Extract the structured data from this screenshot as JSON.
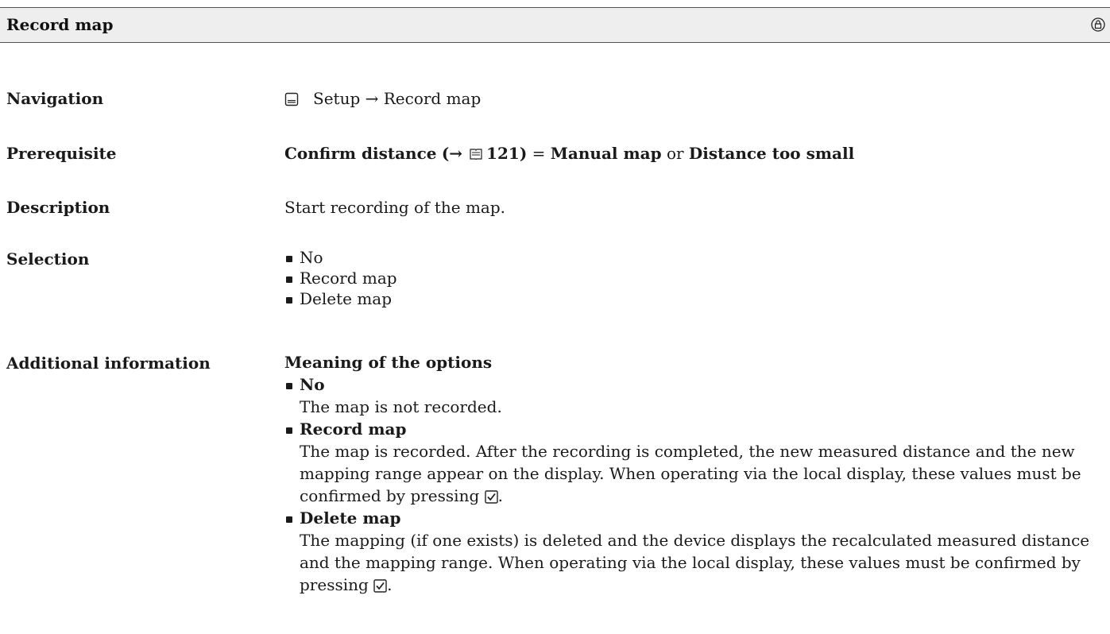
{
  "header": {
    "title": "Record map",
    "icon": "lock-icon"
  },
  "navigation": {
    "label": "Navigation",
    "path": "Setup → Record map",
    "icon": "menu-icon"
  },
  "prerequisite": {
    "label": "Prerequisite",
    "param": "Confirm distance",
    "ref_open": "(→",
    "ref_page": "121)",
    "equals": "=",
    "value1": "Manual map",
    "or": "or",
    "value2": "Distance too small"
  },
  "description": {
    "label": "Description",
    "text": "Start recording of the map."
  },
  "selection": {
    "label": "Selection",
    "options": [
      "No",
      "Record map",
      "Delete map"
    ]
  },
  "additional": {
    "label": "Additional information",
    "heading": "Meaning of the options",
    "items": [
      {
        "name": "No",
        "text": "The map is not recorded."
      },
      {
        "name": "Record map",
        "text": "The map is recorded. After the recording is completed, the new measured distance and the new mapping range appear on the display. When operating via the local display, these values must be confirmed by pressing"
      },
      {
        "name": "Delete map",
        "text": "The mapping (if one exists) is deleted and the device displays the recalculated measured distance and the mapping range. When operating via the local display, these values must be confirmed by pressing"
      }
    ],
    "end_punct": "."
  }
}
